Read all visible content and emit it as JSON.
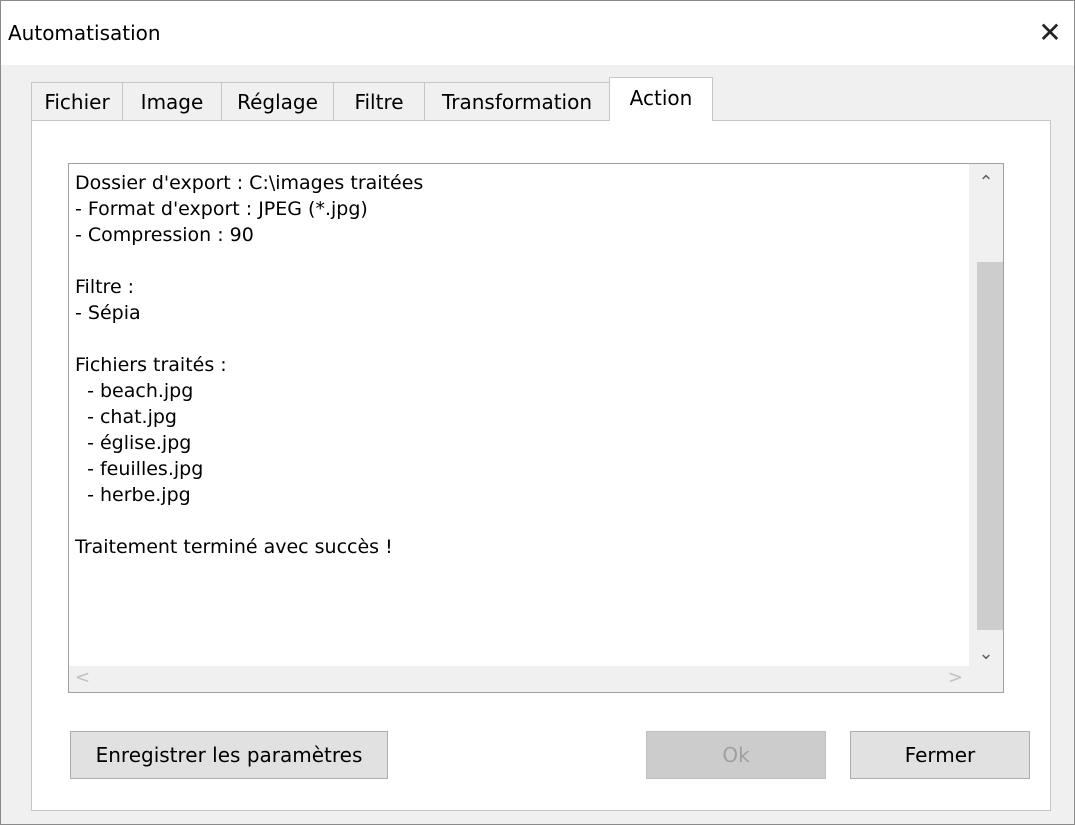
{
  "window": {
    "title": "Automatisation",
    "close_glyph": "✕"
  },
  "tabs": [
    {
      "label": "Fichier",
      "active": false
    },
    {
      "label": "Image",
      "active": false
    },
    {
      "label": "Réglage",
      "active": false
    },
    {
      "label": "Filtre",
      "active": false
    },
    {
      "label": "Transformation",
      "active": false
    },
    {
      "label": "Action",
      "active": true
    }
  ],
  "log": {
    "lines": [
      "Dossier d'export : C:\\images traitées",
      "- Format d'export : JPEG (*.jpg)",
      "- Compression : 90",
      "",
      "Filtre :",
      "- Sépia",
      "",
      "Fichiers traités :",
      "  - beach.jpg",
      "  - chat.jpg",
      "  - église.jpg",
      "  - feuilles.jpg",
      "  - herbe.jpg",
      "",
      "Traitement terminé avec succès !"
    ]
  },
  "scrollbar": {
    "up_glyph": "⌃",
    "down_glyph": "⌄",
    "left_glyph": "<",
    "right_glyph": ">"
  },
  "buttons": {
    "save_label": "Enregistrer les paramètres",
    "ok_label": "Ok",
    "close_label": "Fermer"
  }
}
